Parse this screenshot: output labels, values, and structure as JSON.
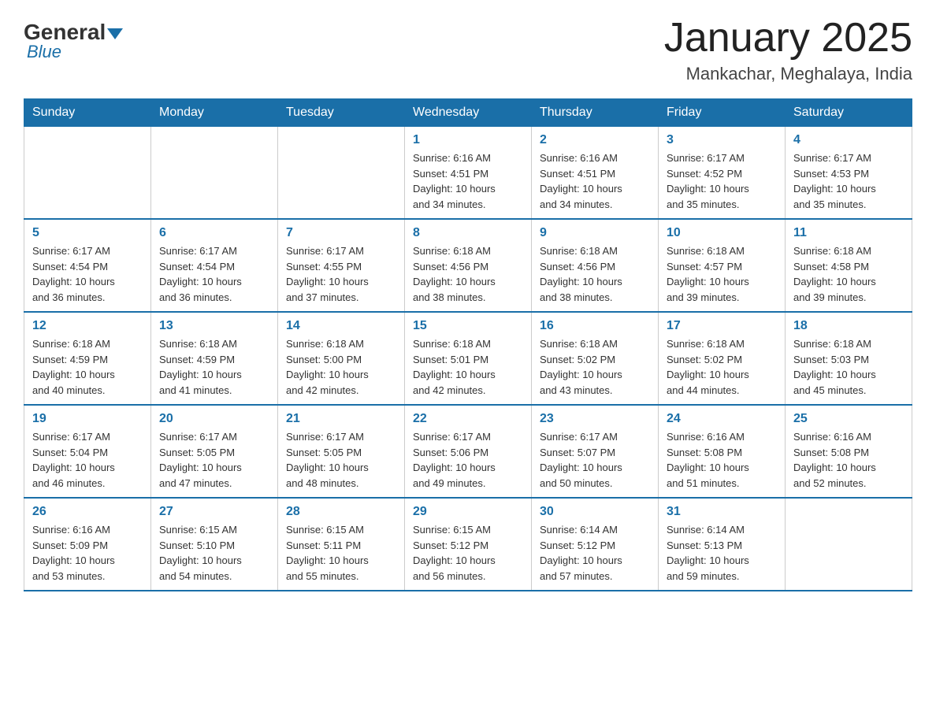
{
  "header": {
    "logo_general": "General",
    "logo_blue": "Blue",
    "month_title": "January 2025",
    "location": "Mankachar, Meghalaya, India"
  },
  "weekdays": [
    "Sunday",
    "Monday",
    "Tuesday",
    "Wednesday",
    "Thursday",
    "Friday",
    "Saturday"
  ],
  "weeks": [
    [
      {
        "day": "",
        "info": ""
      },
      {
        "day": "",
        "info": ""
      },
      {
        "day": "",
        "info": ""
      },
      {
        "day": "1",
        "info": "Sunrise: 6:16 AM\nSunset: 4:51 PM\nDaylight: 10 hours\nand 34 minutes."
      },
      {
        "day": "2",
        "info": "Sunrise: 6:16 AM\nSunset: 4:51 PM\nDaylight: 10 hours\nand 34 minutes."
      },
      {
        "day": "3",
        "info": "Sunrise: 6:17 AM\nSunset: 4:52 PM\nDaylight: 10 hours\nand 35 minutes."
      },
      {
        "day": "4",
        "info": "Sunrise: 6:17 AM\nSunset: 4:53 PM\nDaylight: 10 hours\nand 35 minutes."
      }
    ],
    [
      {
        "day": "5",
        "info": "Sunrise: 6:17 AM\nSunset: 4:54 PM\nDaylight: 10 hours\nand 36 minutes."
      },
      {
        "day": "6",
        "info": "Sunrise: 6:17 AM\nSunset: 4:54 PM\nDaylight: 10 hours\nand 36 minutes."
      },
      {
        "day": "7",
        "info": "Sunrise: 6:17 AM\nSunset: 4:55 PM\nDaylight: 10 hours\nand 37 minutes."
      },
      {
        "day": "8",
        "info": "Sunrise: 6:18 AM\nSunset: 4:56 PM\nDaylight: 10 hours\nand 38 minutes."
      },
      {
        "day": "9",
        "info": "Sunrise: 6:18 AM\nSunset: 4:56 PM\nDaylight: 10 hours\nand 38 minutes."
      },
      {
        "day": "10",
        "info": "Sunrise: 6:18 AM\nSunset: 4:57 PM\nDaylight: 10 hours\nand 39 minutes."
      },
      {
        "day": "11",
        "info": "Sunrise: 6:18 AM\nSunset: 4:58 PM\nDaylight: 10 hours\nand 39 minutes."
      }
    ],
    [
      {
        "day": "12",
        "info": "Sunrise: 6:18 AM\nSunset: 4:59 PM\nDaylight: 10 hours\nand 40 minutes."
      },
      {
        "day": "13",
        "info": "Sunrise: 6:18 AM\nSunset: 4:59 PM\nDaylight: 10 hours\nand 41 minutes."
      },
      {
        "day": "14",
        "info": "Sunrise: 6:18 AM\nSunset: 5:00 PM\nDaylight: 10 hours\nand 42 minutes."
      },
      {
        "day": "15",
        "info": "Sunrise: 6:18 AM\nSunset: 5:01 PM\nDaylight: 10 hours\nand 42 minutes."
      },
      {
        "day": "16",
        "info": "Sunrise: 6:18 AM\nSunset: 5:02 PM\nDaylight: 10 hours\nand 43 minutes."
      },
      {
        "day": "17",
        "info": "Sunrise: 6:18 AM\nSunset: 5:02 PM\nDaylight: 10 hours\nand 44 minutes."
      },
      {
        "day": "18",
        "info": "Sunrise: 6:18 AM\nSunset: 5:03 PM\nDaylight: 10 hours\nand 45 minutes."
      }
    ],
    [
      {
        "day": "19",
        "info": "Sunrise: 6:17 AM\nSunset: 5:04 PM\nDaylight: 10 hours\nand 46 minutes."
      },
      {
        "day": "20",
        "info": "Sunrise: 6:17 AM\nSunset: 5:05 PM\nDaylight: 10 hours\nand 47 minutes."
      },
      {
        "day": "21",
        "info": "Sunrise: 6:17 AM\nSunset: 5:05 PM\nDaylight: 10 hours\nand 48 minutes."
      },
      {
        "day": "22",
        "info": "Sunrise: 6:17 AM\nSunset: 5:06 PM\nDaylight: 10 hours\nand 49 minutes."
      },
      {
        "day": "23",
        "info": "Sunrise: 6:17 AM\nSunset: 5:07 PM\nDaylight: 10 hours\nand 50 minutes."
      },
      {
        "day": "24",
        "info": "Sunrise: 6:16 AM\nSunset: 5:08 PM\nDaylight: 10 hours\nand 51 minutes."
      },
      {
        "day": "25",
        "info": "Sunrise: 6:16 AM\nSunset: 5:08 PM\nDaylight: 10 hours\nand 52 minutes."
      }
    ],
    [
      {
        "day": "26",
        "info": "Sunrise: 6:16 AM\nSunset: 5:09 PM\nDaylight: 10 hours\nand 53 minutes."
      },
      {
        "day": "27",
        "info": "Sunrise: 6:15 AM\nSunset: 5:10 PM\nDaylight: 10 hours\nand 54 minutes."
      },
      {
        "day": "28",
        "info": "Sunrise: 6:15 AM\nSunset: 5:11 PM\nDaylight: 10 hours\nand 55 minutes."
      },
      {
        "day": "29",
        "info": "Sunrise: 6:15 AM\nSunset: 5:12 PM\nDaylight: 10 hours\nand 56 minutes."
      },
      {
        "day": "30",
        "info": "Sunrise: 6:14 AM\nSunset: 5:12 PM\nDaylight: 10 hours\nand 57 minutes."
      },
      {
        "day": "31",
        "info": "Sunrise: 6:14 AM\nSunset: 5:13 PM\nDaylight: 10 hours\nand 59 minutes."
      },
      {
        "day": "",
        "info": ""
      }
    ]
  ]
}
